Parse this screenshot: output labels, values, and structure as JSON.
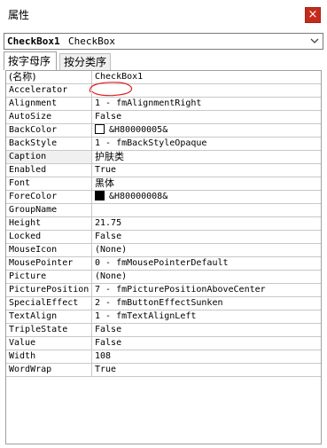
{
  "window": {
    "title": "属性",
    "close_label": "×"
  },
  "object_selector": {
    "name": "CheckBox1",
    "type": "CheckBox"
  },
  "tabs": [
    {
      "label": "按字母序",
      "active": true
    },
    {
      "label": "按分类序",
      "active": false
    }
  ],
  "properties": [
    {
      "name": "(名称)",
      "value": "CheckBox1"
    },
    {
      "name": "Accelerator",
      "value": ""
    },
    {
      "name": "Alignment",
      "value": "1 - fmAlignmentRight"
    },
    {
      "name": "AutoSize",
      "value": "False"
    },
    {
      "name": "BackColor",
      "value": "&H80000005&",
      "swatch": "#ffffff"
    },
    {
      "name": "BackStyle",
      "value": "1 - fmBackStyleOpaque"
    },
    {
      "name": "Caption",
      "value": "护肤类",
      "selected": true
    },
    {
      "name": "Enabled",
      "value": "True"
    },
    {
      "name": "Font",
      "value": "黑体"
    },
    {
      "name": "ForeColor",
      "value": "&H80000008&",
      "swatch": "#000000"
    },
    {
      "name": "GroupName",
      "value": ""
    },
    {
      "name": "Height",
      "value": "21.75"
    },
    {
      "name": "Locked",
      "value": "False"
    },
    {
      "name": "MouseIcon",
      "value": "(None)"
    },
    {
      "name": "MousePointer",
      "value": "0 - fmMousePointerDefault"
    },
    {
      "name": "Picture",
      "value": "(None)"
    },
    {
      "name": "PicturePosition",
      "value": "7 - fmPicturePositionAboveCenter"
    },
    {
      "name": "SpecialEffect",
      "value": "2 - fmButtonEffectSunken"
    },
    {
      "name": "TextAlign",
      "value": "1 - fmTextAlignLeft"
    },
    {
      "name": "TripleState",
      "value": "False"
    },
    {
      "name": "Value",
      "value": "False"
    },
    {
      "name": "Width",
      "value": "108"
    },
    {
      "name": "WordWrap",
      "value": "True"
    }
  ],
  "colors": {
    "annotation": "#e02020",
    "close_button": "#c42b1c"
  },
  "icons": {
    "close": "close-icon",
    "dropdown": "chevron-down-icon"
  }
}
